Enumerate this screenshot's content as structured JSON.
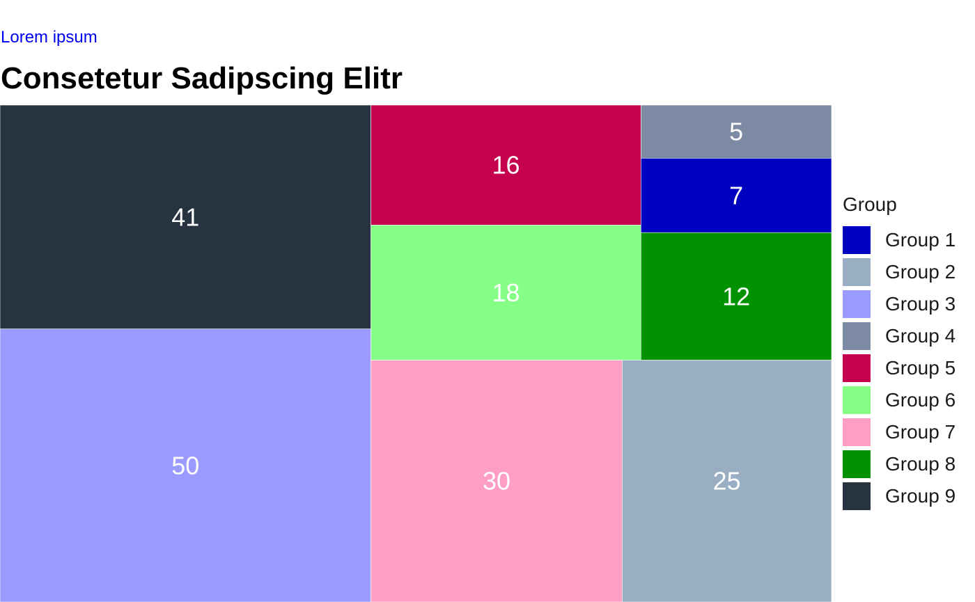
{
  "header": {
    "link_text": "Lorem ipsum",
    "title": "Consetetur Sadipscing Elitr"
  },
  "legend": {
    "title": "Group"
  },
  "chart_data": {
    "type": "treemap",
    "title": "Consetetur Sadipscing Elitr",
    "subtitle": "Lorem ipsum",
    "legend_title": "Group",
    "legend_position": "right",
    "label_color": "#ffffff",
    "border_color": "#ffffff",
    "groups": [
      {
        "name": "Group 1",
        "value": 7,
        "color": "#0000c0"
      },
      {
        "name": "Group 2",
        "value": 25,
        "color": "#9aaec3"
      },
      {
        "name": "Group 3",
        "value": 50,
        "color": "#9a9aff"
      },
      {
        "name": "Group 4",
        "value": 5,
        "color": "#7d8aa3"
      },
      {
        "name": "Group 5",
        "value": 16,
        "color": "#c5004e"
      },
      {
        "name": "Group 6",
        "value": 18,
        "color": "#86ff86"
      },
      {
        "name": "Group 7",
        "value": 30,
        "color": "#ff9ec4"
      },
      {
        "name": "Group 8",
        "value": 12,
        "color": "#009200"
      },
      {
        "name": "Group 9",
        "value": 41,
        "color": "#283341"
      }
    ]
  }
}
